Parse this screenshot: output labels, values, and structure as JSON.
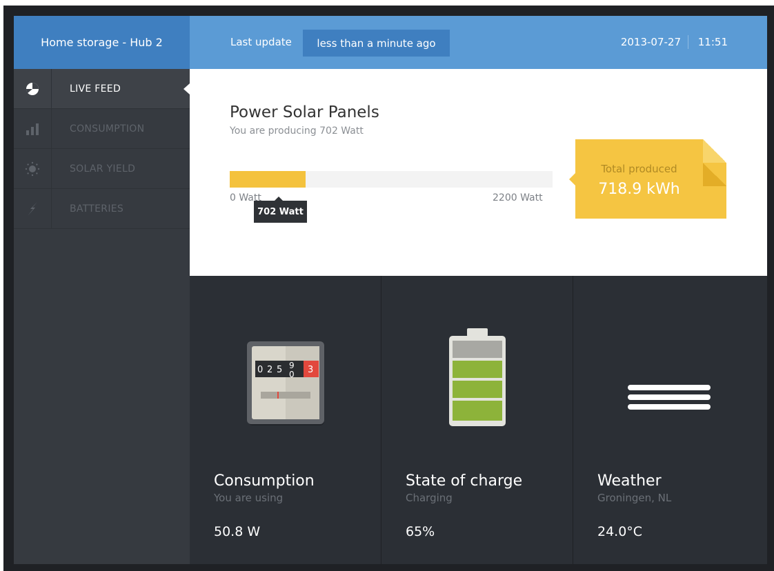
{
  "sidebar": {
    "hub_title": "Home storage - Hub 2",
    "items": [
      {
        "label": "LIVE FEED",
        "icon": "pie-chart-icon",
        "active": true
      },
      {
        "label": "CONSUMPTION",
        "icon": "bar-chart-icon",
        "active": false
      },
      {
        "label": "SOLAR YIELD",
        "icon": "sun-icon",
        "active": false
      },
      {
        "label": "BATTERIES",
        "icon": "lightning-icon",
        "active": false
      }
    ]
  },
  "header": {
    "last_update_label": "Last update",
    "last_update_value": "less than a minute ago",
    "date": "2013-07-27",
    "time": "11:51"
  },
  "solar": {
    "title": "Power Solar Panels",
    "subtitle": "You are producing 702 Watt",
    "bar_min": "0 Watt",
    "bar_max": "2200 Watt",
    "tooltip": "702 Watt",
    "current_watt": 702,
    "max_watt": 2200,
    "total_label": "Total produced",
    "total_value": "718.9 kWh"
  },
  "tiles": {
    "consumption": {
      "title": "Consumption",
      "subtitle": "You are using",
      "value": "50.8 W",
      "icon": "electric-meter-icon",
      "meter_digits": [
        "0",
        "2",
        "5",
        "9",
        "3"
      ],
      "meter_rolling_digit": "0"
    },
    "charge": {
      "title": "State of charge",
      "subtitle": "Charging",
      "value": "65%",
      "icon": "battery-icon",
      "charge_fraction": 0.65
    },
    "weather": {
      "title": "Weather",
      "subtitle": "Groningen, NL",
      "value": "24.0°C",
      "icon": "fog-icon"
    }
  },
  "colors": {
    "accent_blue": "#5b9bd5",
    "dark_blue": "#3f7fc0",
    "solar_yellow": "#f4c23d",
    "battery_green": "#8db33a",
    "meter_red": "#e2483d"
  }
}
